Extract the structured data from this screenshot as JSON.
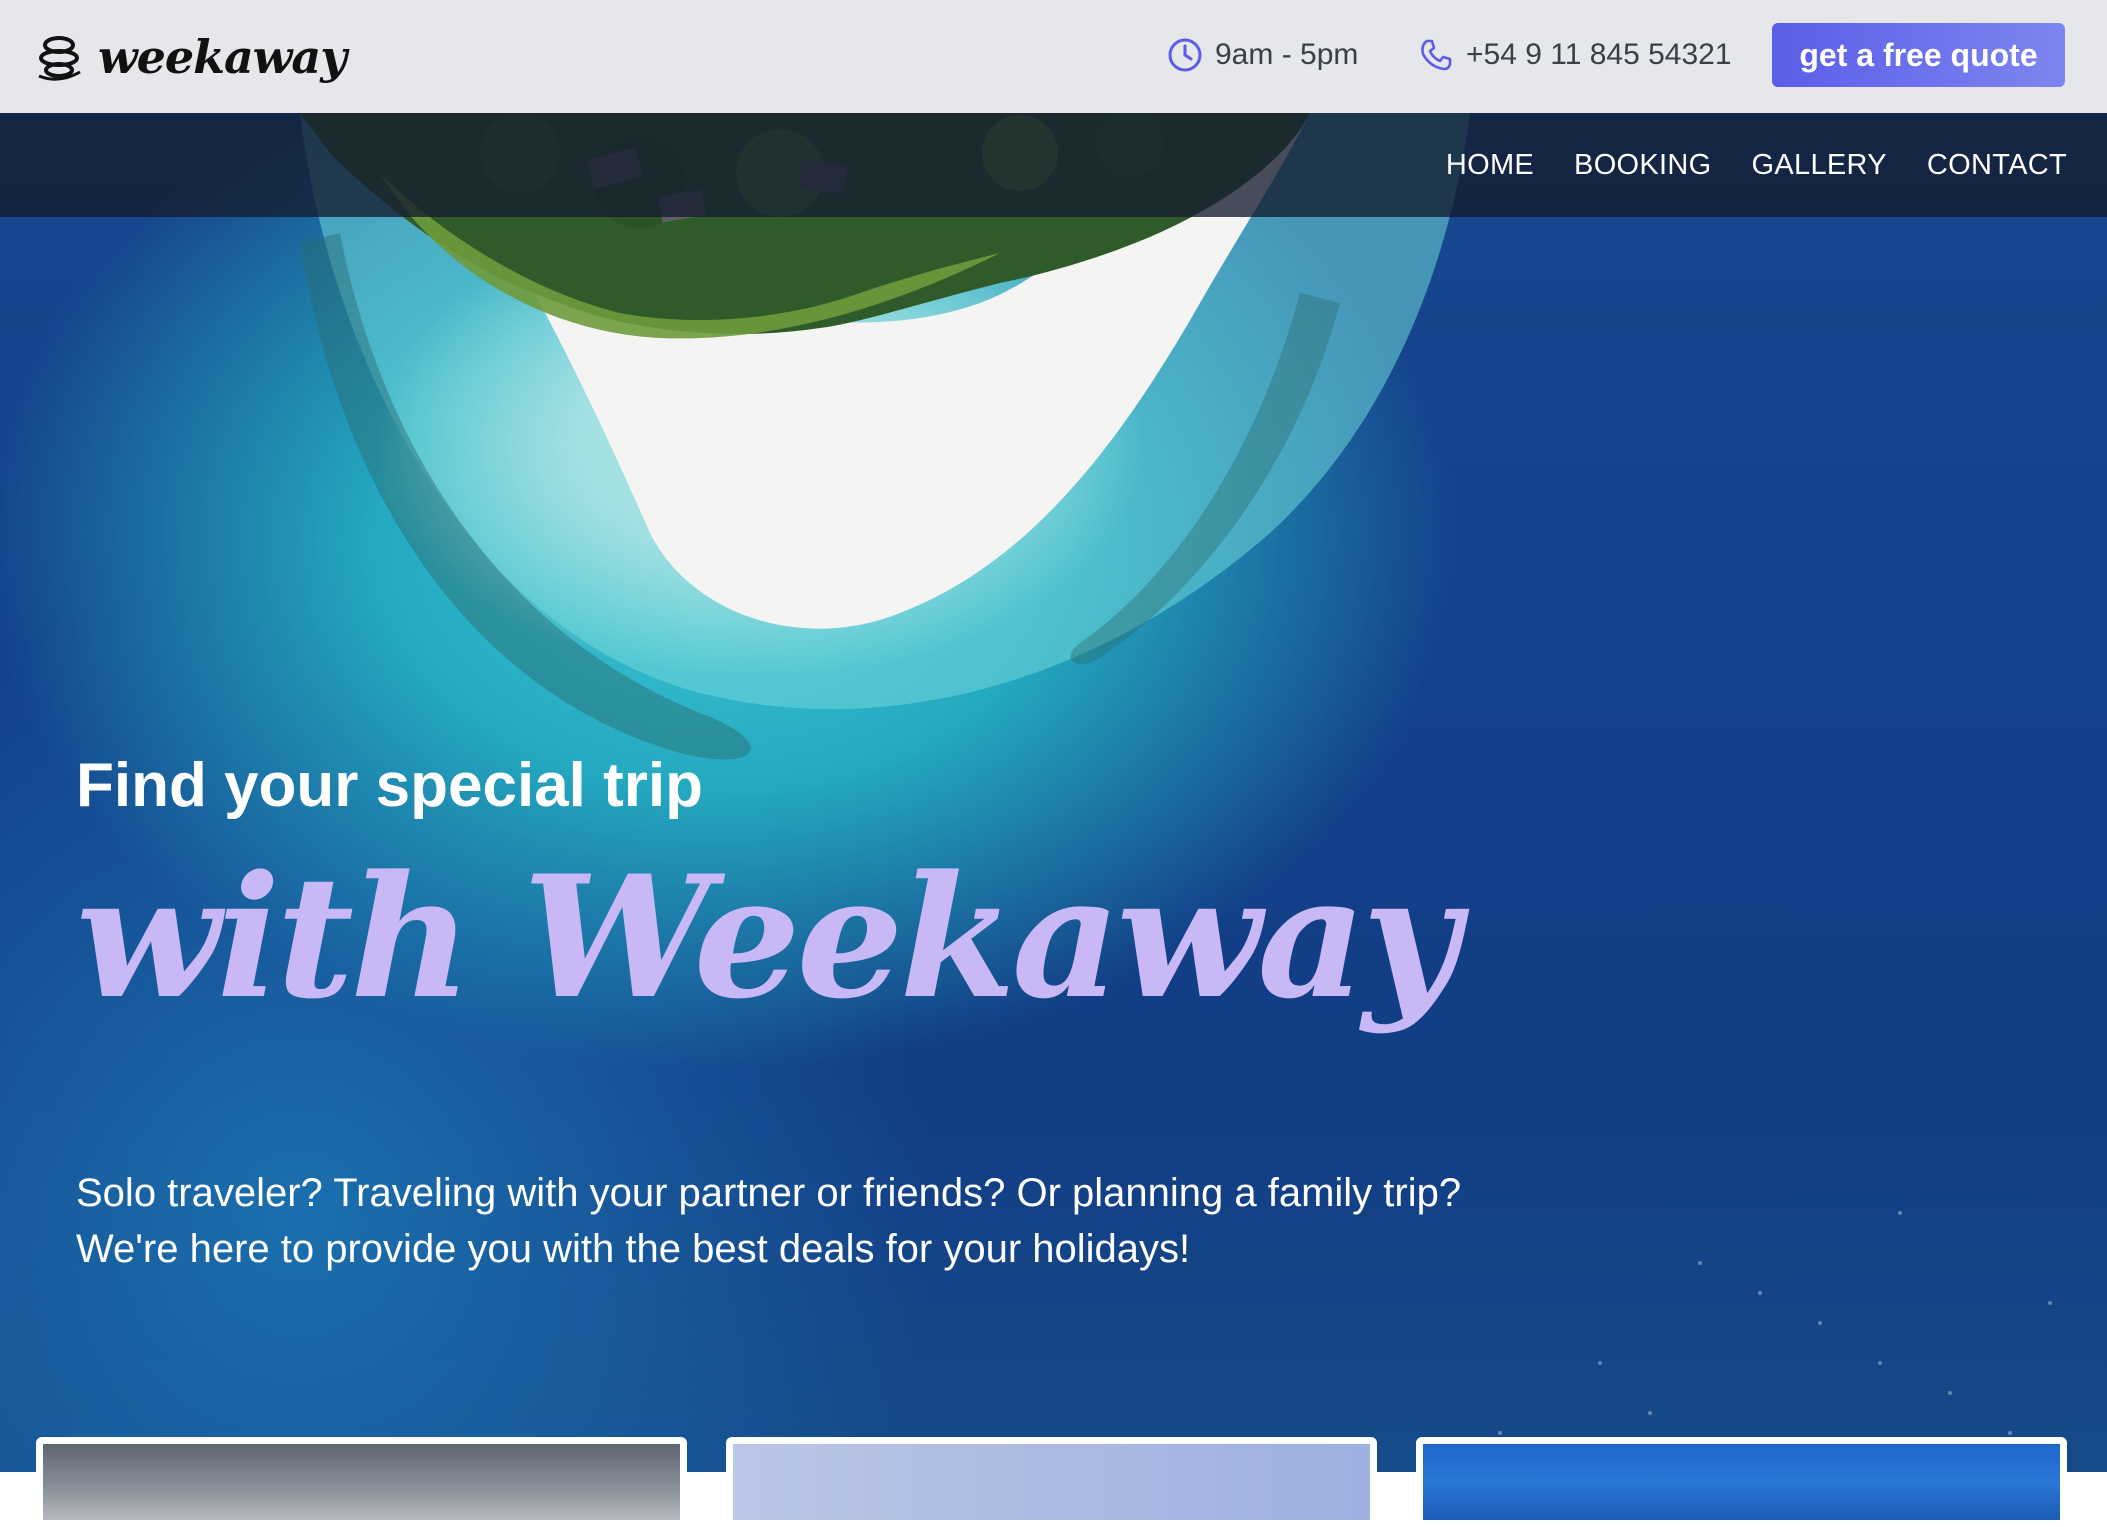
{
  "header": {
    "logo_text": "weekaway",
    "hours": "9am - 5pm",
    "phone": "+54 9 11 845 54321",
    "quote_button": "get a free quote"
  },
  "nav": {
    "items": [
      {
        "label": "HOME"
      },
      {
        "label": "BOOKING"
      },
      {
        "label": "GALLERY"
      },
      {
        "label": "CONTACT"
      }
    ]
  },
  "hero": {
    "title": "Find your special trip",
    "script": "with Weekaway",
    "description_line1": "Solo traveler? Traveling with your partner or friends? Or planning a family trip?",
    "description_line2": "We're here to provide you with the best deals for your holidays!"
  },
  "icons": {
    "logo": "globe-logo-icon",
    "hours": "clock-icon",
    "phone": "phone-icon"
  },
  "colors": {
    "accent": "#5b5de8",
    "script_text": "#c8b8f5",
    "topbar_bg": "#e6e7ea",
    "nav_bg": "#141c30"
  }
}
